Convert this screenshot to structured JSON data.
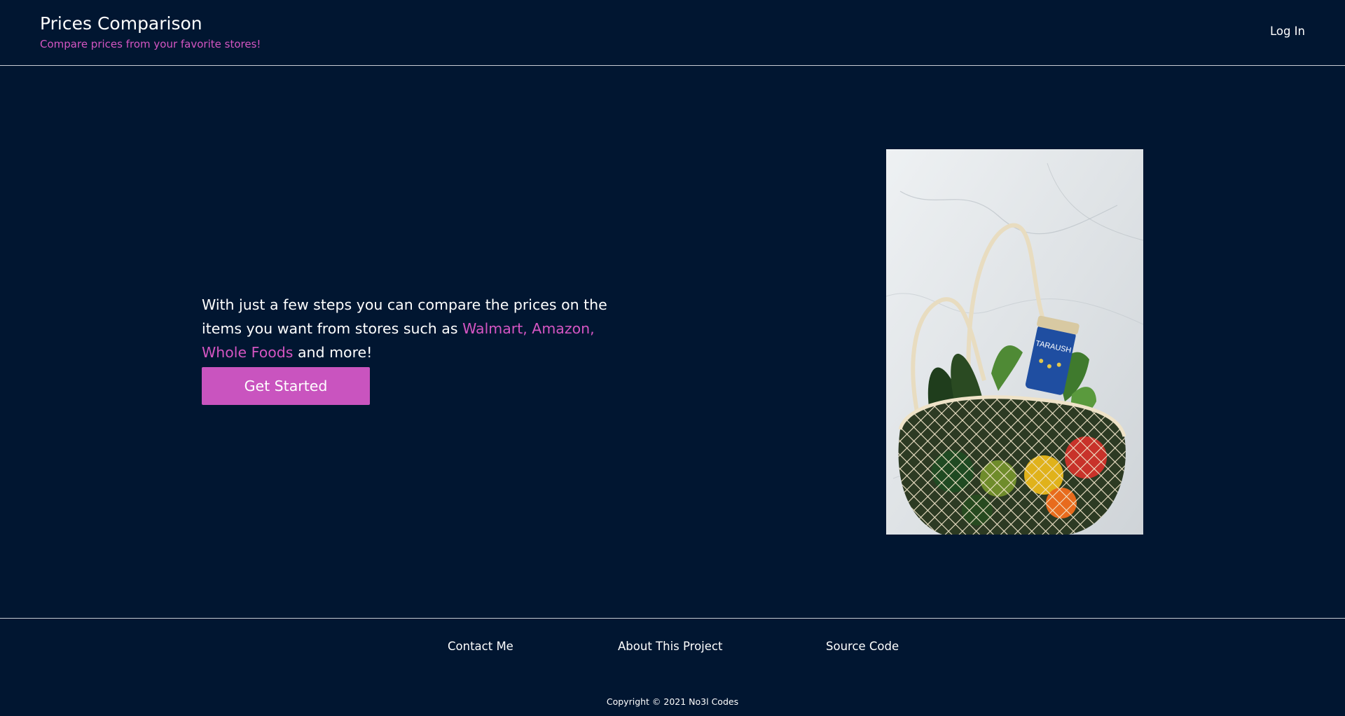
{
  "header": {
    "title": "Prices Comparison",
    "subtitle": "Compare prices from your favorite stores!",
    "login_label": "Log In"
  },
  "hero": {
    "text_before": "With just a few steps you can compare the prices on the items you want from stores such as ",
    "stores_highlight": "Walmart, Amazon, Whole Foods",
    "text_after": " and more!",
    "cta_label": "Get Started",
    "image_subject": "grocery-mesh-bag-photo",
    "jar_label": "TARAUSH"
  },
  "footer": {
    "links": [
      "Contact Me",
      "About This Project",
      "Source Code"
    ],
    "copyright": "Copyright © 2021 No3l Codes"
  },
  "colors": {
    "background": "#011631",
    "accent": "#d455c2",
    "button": "#c954bf",
    "divider": "#c8ccd4",
    "text": "#ffffff"
  }
}
